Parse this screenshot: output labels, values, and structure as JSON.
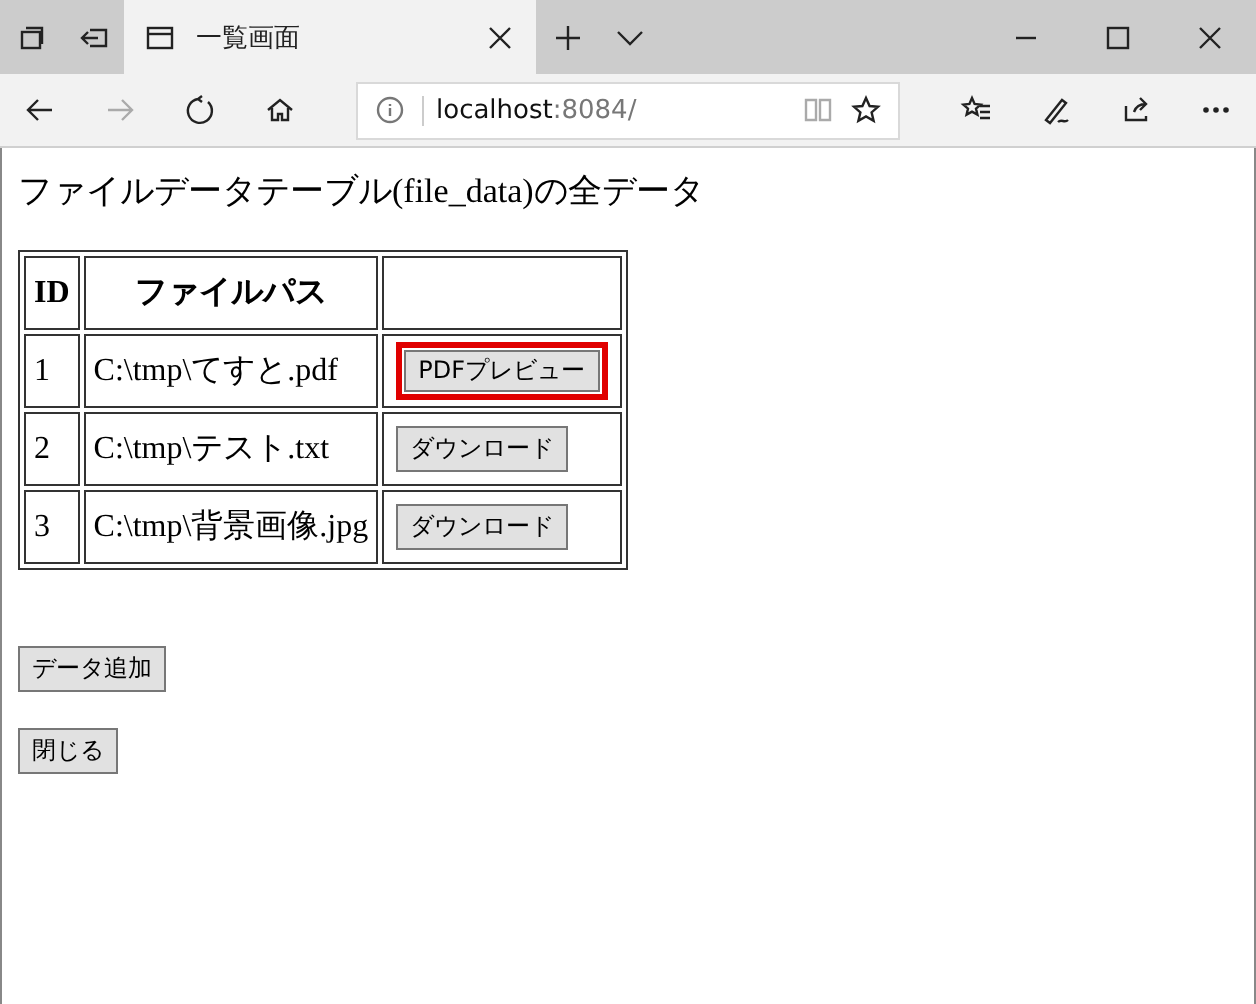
{
  "window": {
    "tab_title": "一覧画面"
  },
  "address_bar": {
    "host": "localhost",
    "port_path": ":8084/"
  },
  "page": {
    "heading": "ファイルデータテーブル(file_data)の全データ",
    "table": {
      "columns": [
        "ID",
        "ファイルパス"
      ],
      "rows": [
        {
          "id": "1",
          "path": "C:\\tmp\\てすと.pdf",
          "button": {
            "label": "PDFプレビュー",
            "highlighted": true
          }
        },
        {
          "id": "2",
          "path": "C:\\tmp\\テスト.txt",
          "button": {
            "label": "ダウンロード",
            "highlighted": false
          }
        },
        {
          "id": "3",
          "path": "C:\\tmp\\背景画像.jpg",
          "button": {
            "label": "ダウンロード",
            "highlighted": false
          }
        }
      ]
    },
    "buttons": [
      "データ追加",
      "閉じる"
    ]
  }
}
